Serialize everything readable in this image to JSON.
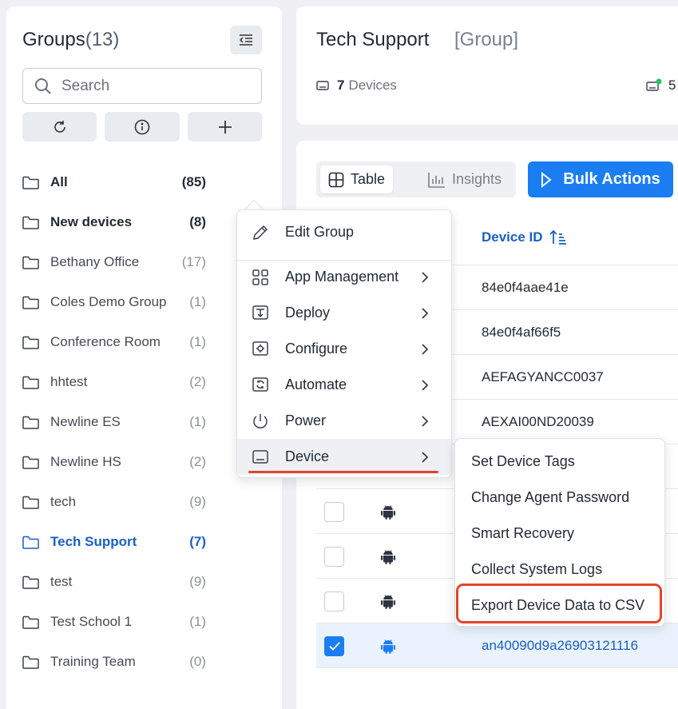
{
  "sidebar": {
    "title": "Groups",
    "count": "(13)",
    "search_placeholder": "Search",
    "groups": [
      {
        "name": "All",
        "count": "(85)"
      },
      {
        "name": "New devices",
        "count": "(8)"
      },
      {
        "name": "Bethany Office",
        "count": "(17)"
      },
      {
        "name": "Coles Demo Group",
        "count": "(1)"
      },
      {
        "name": "Conference Room",
        "count": "(1)"
      },
      {
        "name": "hhtest",
        "count": "(2)"
      },
      {
        "name": "Newline ES",
        "count": "(1)"
      },
      {
        "name": "Newline HS",
        "count": "(2)"
      },
      {
        "name": "tech",
        "count": "(9)"
      },
      {
        "name": "Tech Support",
        "count": "(7)"
      },
      {
        "name": "test",
        "count": "(9)"
      },
      {
        "name": "Test School 1",
        "count": "(1)"
      },
      {
        "name": "Training Team",
        "count": "(0)"
      }
    ]
  },
  "header": {
    "title": "Tech Support",
    "subtitle": "[Group]",
    "device_count": "7",
    "device_label": "Devices",
    "online_count": "5"
  },
  "toolbar": {
    "table_label": "Table",
    "insights_label": "Insights",
    "bulk_label": "Bulk Actions"
  },
  "table": {
    "column_device_id": "Device ID",
    "rows": [
      {
        "device_id": "84e0f4aae41e"
      },
      {
        "device_id": "84e0f4af66f5"
      },
      {
        "device_id": "AEFAGYANCC0037"
      },
      {
        "device_id": "AEXAI00ND20039"
      },
      {
        "device_id": ""
      },
      {
        "device_id": ""
      },
      {
        "device_id": ""
      },
      {
        "device_id": "an40090d9a26903121116"
      }
    ]
  },
  "context_menu": {
    "items": [
      {
        "label": "Edit Group"
      },
      {
        "label": "App Management"
      },
      {
        "label": "Deploy"
      },
      {
        "label": "Configure"
      },
      {
        "label": "Automate"
      },
      {
        "label": "Power"
      },
      {
        "label": "Device"
      }
    ]
  },
  "device_submenu": {
    "items": [
      {
        "label": "Set Device Tags"
      },
      {
        "label": "Change Agent Password"
      },
      {
        "label": "Smart Recovery"
      },
      {
        "label": "Collect System Logs"
      },
      {
        "label": "Export Device Data to CSV"
      }
    ]
  },
  "colors": {
    "accent": "#1a7ef2",
    "active_text": "#1a5fc4",
    "highlight": "#e0452d",
    "online_dot": "#22c55e"
  }
}
